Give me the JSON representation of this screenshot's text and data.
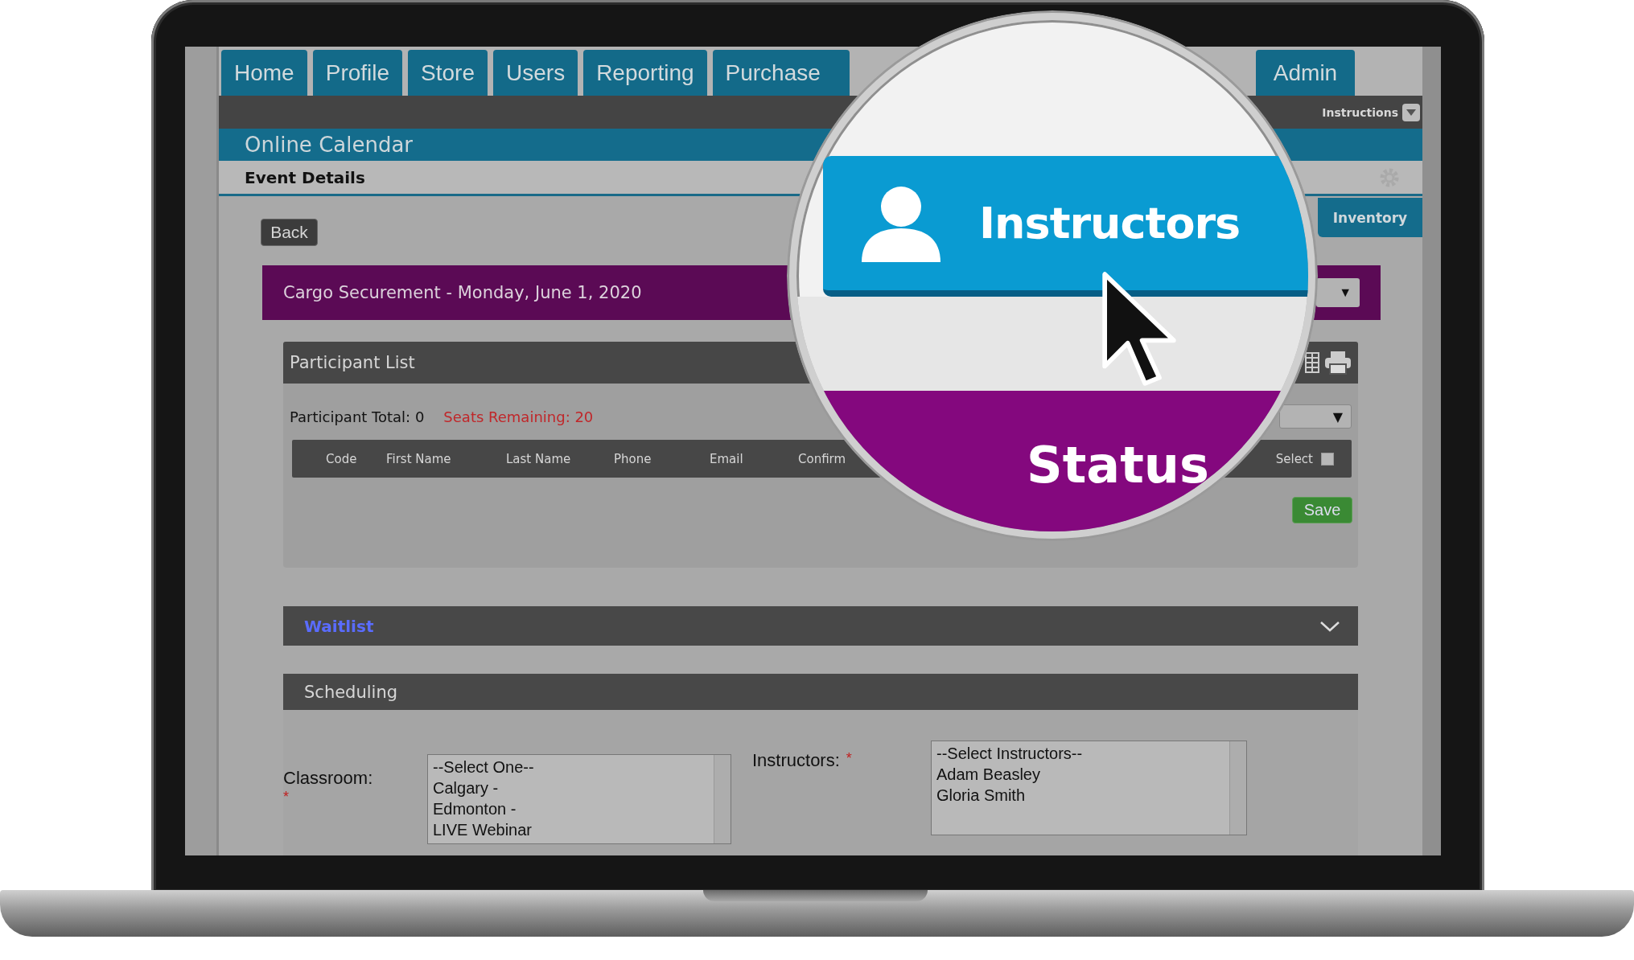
{
  "nav_tabs": [
    {
      "label": "Home"
    },
    {
      "label": "Profile"
    },
    {
      "label": "Store"
    },
    {
      "label": "Users"
    },
    {
      "label": "Reporting"
    },
    {
      "label": "Purchase"
    },
    {
      "label": "Admin"
    }
  ],
  "instructions_button": {
    "label": "Instructions"
  },
  "page_title": "Online Calendar",
  "section_title": "Event Details",
  "side_tab": {
    "label": "Inventory"
  },
  "back_button": {
    "label": "Back"
  },
  "event_bar": {
    "title": "Cargo Securement - Monday, June 1, 2020",
    "dropdown_arrow": "▼"
  },
  "participant_list": {
    "title": "Participant List",
    "total": "Participant Total: 0",
    "seats": "Seats Remaining: 20",
    "filter_arrow": "▼",
    "columns": [
      "Code",
      "First Name",
      "Last Name",
      "Phone",
      "Email",
      "Confirm"
    ],
    "select_label": "Select",
    "select_all_checked": false,
    "save_button": "Save"
  },
  "waitlist": {
    "title": "Waitlist",
    "expanded": false
  },
  "scheduling": {
    "title": "Scheduling",
    "classroom": {
      "label": "Classroom:",
      "required_mark": "*",
      "options": [
        "--Select One--",
        "Calgary -",
        "Edmonton -",
        "LIVE Webinar"
      ]
    },
    "instructors": {
      "label": "Instructors:",
      "required_mark": "*",
      "options": [
        "--Select Instructors--",
        "Adam Beasley",
        "Gloria Smith"
      ]
    }
  },
  "magnifier": {
    "tab_label": "Instructors",
    "band_label": "Status"
  }
}
